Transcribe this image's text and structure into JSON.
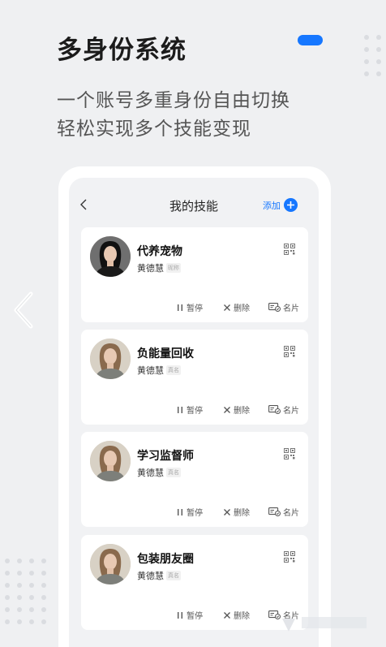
{
  "headline": "多身份系统",
  "subtitle_lines": [
    "一个账号多重身份自由切换",
    "轻松实现多个技能变现"
  ],
  "colors": {
    "accent": "#1677ff",
    "background": "#eff0f2"
  },
  "screen": {
    "back_icon": "chevron-left-icon",
    "title": "我的技能",
    "add_label": "添加"
  },
  "cards": [
    {
      "title": "代养宠物",
      "owner": "黄德慧",
      "tag": "昵称",
      "avatar": "woman-dark-hair"
    },
    {
      "title": "负能量回收",
      "owner": "黄德慧",
      "tag": "真名",
      "avatar": "woman-light-hair"
    },
    {
      "title": "学习监督师",
      "owner": "黄德慧",
      "tag": "真名",
      "avatar": "woman-light-hair"
    },
    {
      "title": "包装朋友圈",
      "owner": "黄德慧",
      "tag": "真名",
      "avatar": "woman-light-hair"
    }
  ],
  "actions": {
    "pause": "暂停",
    "delete": "删除",
    "card": "名片"
  }
}
